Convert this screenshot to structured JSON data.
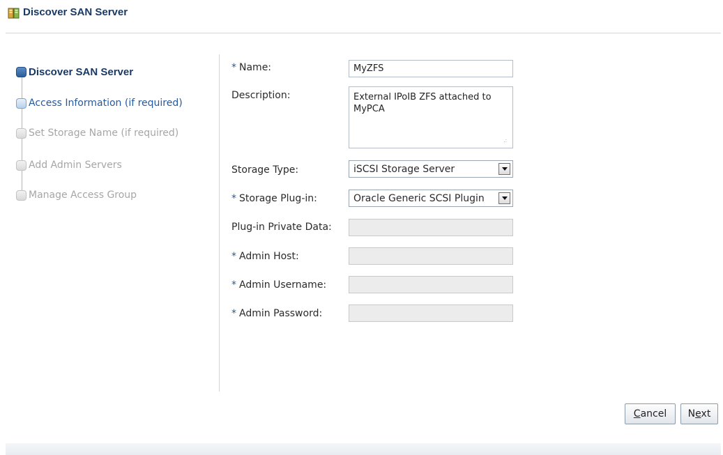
{
  "dialog": {
    "title": "Discover SAN Server",
    "icon": "san-server-icon"
  },
  "train": {
    "steps": [
      {
        "label": "Discover SAN Server",
        "state": "current"
      },
      {
        "label": "Access Information (if required)",
        "state": "visited"
      },
      {
        "label": "Set Storage Name (if required)",
        "state": "disabled"
      },
      {
        "label": "Add Admin Servers",
        "state": "disabled"
      },
      {
        "label": "Manage Access Group",
        "state": "disabled"
      }
    ]
  },
  "form": {
    "name": {
      "label": "Name:",
      "required": "*",
      "value": "MyZFS"
    },
    "description": {
      "label": "Description:",
      "value": "External IPoIB ZFS attached to MyPCA"
    },
    "storage_type": {
      "label": "Storage Type:",
      "value": "iSCSI Storage Server"
    },
    "storage_plugin": {
      "label": "Storage Plug-in:",
      "required": "*",
      "value": "Oracle Generic SCSI Plugin"
    },
    "plugin_private_data": {
      "label": "Plug-in Private Data:",
      "value": ""
    },
    "admin_host": {
      "label": "Admin Host:",
      "required": "*",
      "value": ""
    },
    "admin_username": {
      "label": "Admin Username:",
      "required": "*",
      "value": ""
    },
    "admin_password": {
      "label": "Admin Password:",
      "required": "*",
      "value": ""
    }
  },
  "buttons": {
    "cancel": {
      "mnemonic": "C",
      "rest": "ancel"
    },
    "next": {
      "prefix": "N",
      "mnemonic": "e",
      "rest": "xt"
    }
  },
  "colors": {
    "title": "#1a3a66",
    "link": "#2559a0",
    "disabled_text": "#a6a6a6"
  }
}
